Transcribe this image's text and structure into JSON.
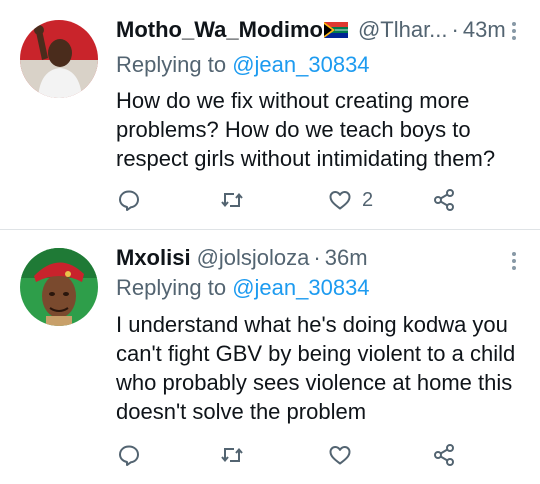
{
  "tweets": [
    {
      "display_name": "Motho_Wa_Modimo",
      "flag_icon": "south-africa-flag-icon",
      "handle": "@Tlhar...",
      "separator": "·",
      "time": "43m",
      "replying_label": "Replying to",
      "replying_to": "@jean_30834",
      "text": "How do we fix without creating more problems? How do we teach boys to respect girls without intimidating them?",
      "like_count": "2",
      "icons": [
        "reply-icon",
        "retweet-icon",
        "like-icon",
        "share-icon",
        "more-icon"
      ]
    },
    {
      "display_name": "Mxolisi",
      "handle": "@jolsjoloza",
      "separator": "·",
      "time": "36m",
      "replying_label": "Replying to",
      "replying_to": "@jean_30834",
      "text": "I understand what he's doing kodwa you can't fight GBV by being violent to a child who probably sees violence at home this doesn't solve the problem",
      "like_count": "",
      "icons": [
        "reply-icon",
        "retweet-icon",
        "like-icon",
        "share-icon",
        "more-icon"
      ]
    }
  ],
  "colors": {
    "text_primary": "#0f1419",
    "text_secondary": "#536471",
    "mention": "#1d9bf0",
    "icon": "#536471",
    "divider": "#dfe3e6"
  }
}
